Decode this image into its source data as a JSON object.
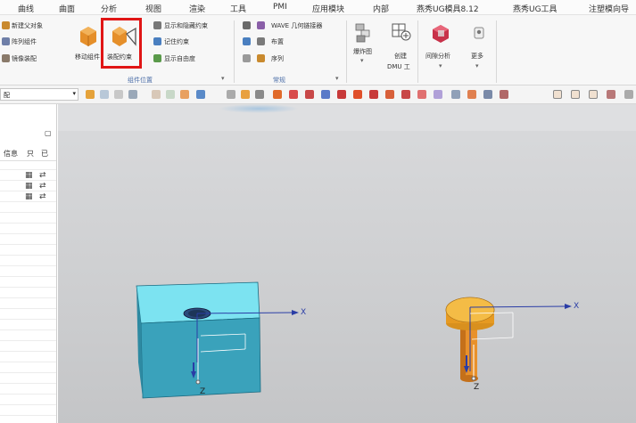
{
  "menubar": {
    "items": [
      "曲线",
      "曲面",
      "分析",
      "视图",
      "渲染",
      "工具",
      "PMI",
      "应用模块",
      "内部",
      "燕秀UG模具8.12",
      "燕秀UG工具",
      "注塑模向导"
    ]
  },
  "ribbon": {
    "left_items": [
      "新建父对象",
      "阵列组件",
      "镜像装配"
    ],
    "move_component": "移动组件",
    "assembly_constraint": "装配约束",
    "constraint_items": [
      "显示和隐藏约束",
      "记住约束",
      "显示自由度"
    ],
    "group_component_position": "组件位置",
    "wave_items": [
      "WAVE 几何链接器",
      "布置",
      "序列"
    ],
    "group_general": "常规",
    "explode": "爆炸图",
    "create_dmu": "创建",
    "dmu_label": "DMU 工",
    "clearance": "间隙分析",
    "more": "更多"
  },
  "toolbar": {
    "selection_filter": "配"
  },
  "panel": {
    "header_info": "信息",
    "header_col1": "只",
    "header_col2": "已",
    "rows": [
      {
        "c1": "▦",
        "c2": "⇄"
      },
      {
        "c1": "▦",
        "c2": "⇄"
      },
      {
        "c1": "▦",
        "c2": "⇄"
      }
    ]
  },
  "viewport": {
    "axis_x": "X",
    "axis_z": "Z",
    "colors": {
      "block_top": "#7ce3f1",
      "block_front": "#3aa2bb",
      "pin": "#f2b23c",
      "axis": "#2a3da6"
    }
  }
}
